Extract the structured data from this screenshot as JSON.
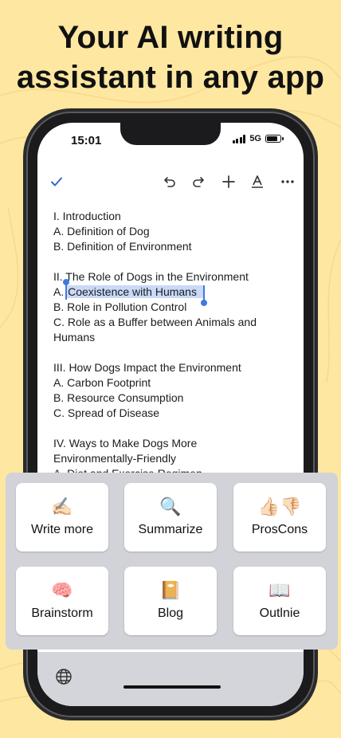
{
  "headline": [
    "Your AI writing",
    "assistant in any app"
  ],
  "status": {
    "time": "15:01",
    "network": "5G",
    "battery_level": 0.85
  },
  "toolbar": {
    "check_icon": "checkmark-icon",
    "undo_icon": "undo-icon",
    "redo_icon": "redo-icon",
    "add_icon": "plus-icon",
    "format_icon": "text-format-icon",
    "more_icon": "more-icon"
  },
  "document": {
    "l1": "I. Introduction",
    "l2": "A. Definition of Dog",
    "l3": "B. Definition of Environment",
    "l4": "II. The Role of Dogs in the Environment",
    "l5_prefix": "A. ",
    "l5_selected": "Coexistence with Humans",
    "l6": "B. Role in Pollution Control",
    "l7": "C. Role as a Buffer between Animals and",
    "l8": "Humans",
    "l9": "III. How Dogs Impact the Environment",
    "l10": "A. Carbon Footprint",
    "l11": "B. Resource Consumption",
    "l12": "C. Spread of Disease",
    "l13": "IV. Ways to Make Dogs More",
    "l14": "Environmentally-Friendly",
    "l15": "A. Diet and Exercise Regimen"
  },
  "actions": [
    {
      "emoji": "✍🏻",
      "label": "Write more"
    },
    {
      "emoji": "🔍",
      "label": "Summarize"
    },
    {
      "emoji": "👍🏻👎🏻",
      "label": "ProsCons"
    },
    {
      "emoji": "🧠",
      "label": "Brainstorm"
    },
    {
      "emoji": "📔",
      "label": "Blog"
    },
    {
      "emoji": "📖",
      "label": "Outlnie"
    }
  ],
  "colors": {
    "background": "#fde7a1",
    "selection": "#c9d9f7",
    "accent": "#3f7ae0"
  }
}
